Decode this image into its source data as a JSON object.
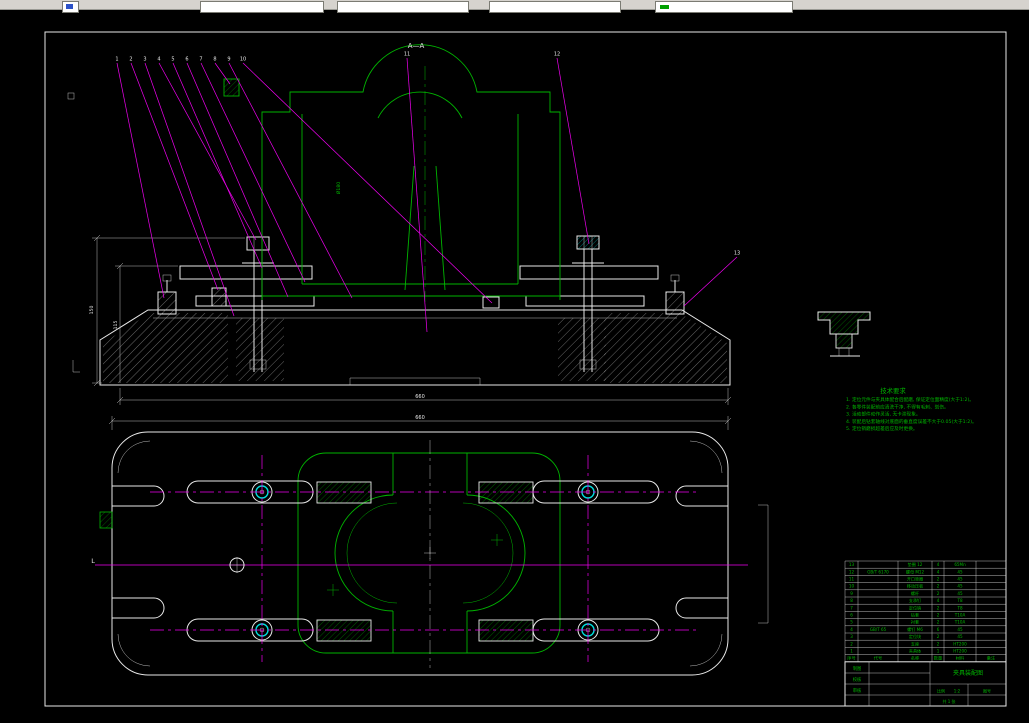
{
  "colors": {
    "background": "#000000",
    "line_white": "#e9e9e9",
    "line_green": "#00b400",
    "line_magenta": "#f000f0",
    "line_cyan": "#00dcdc",
    "toolbar_bg": "#d6d3ce"
  },
  "drawing": {
    "section_label": "A—A",
    "balloons": [
      "1",
      "2",
      "3",
      "4",
      "5",
      "6",
      "7",
      "8",
      "9",
      "10",
      "11",
      "12",
      "13"
    ],
    "dimensions": {
      "overall_width": "660",
      "plan_width": "660",
      "height_a": "150",
      "height_b": "115",
      "bore": "Ø180"
    },
    "view_labels": {
      "left_mark": "L"
    },
    "notes": {
      "title": "技术要求",
      "lines": [
        "1. 定位元件与夹具体配合后配磨, 保证定位面精度(大于1:2)。",
        "2. 各零件装配前应清洗干净, 不得有毛刺、划伤。",
        "3. 活动部件动作灵活, 无卡滞现象。",
        "4. 装配后钻套轴线对底面的垂直度误差不大于0.05(大于1:2)。",
        "5. 定位销磨损超差后应及时更换。"
      ]
    },
    "bom": {
      "headers": [
        "序号",
        "代号",
        "名称",
        "数量",
        "材料",
        "备注"
      ],
      "rows": [
        [
          "13",
          "",
          "垫圈 12",
          "4",
          "65Mn",
          ""
        ],
        [
          "12",
          "GB/T 6170",
          "螺母 M12",
          "4",
          "45",
          ""
        ],
        [
          "11",
          "",
          "开口垫圈",
          "2",
          "45",
          ""
        ],
        [
          "10",
          "",
          "移动压板",
          "2",
          "45",
          ""
        ],
        [
          "9",
          "",
          "螺杆",
          "2",
          "45",
          ""
        ],
        [
          "8",
          "",
          "支承钉",
          "4",
          "T8",
          ""
        ],
        [
          "7",
          "",
          "定位销",
          "2",
          "T8",
          ""
        ],
        [
          "6",
          "",
          "钻套",
          "2",
          "T10A",
          ""
        ],
        [
          "5",
          "",
          "衬套",
          "2",
          "T10A",
          ""
        ],
        [
          "4",
          "GB/T 65",
          "螺钉 M6",
          "6",
          "45",
          ""
        ],
        [
          "3",
          "",
          "定位块",
          "2",
          "45",
          ""
        ],
        [
          "2",
          "",
          "支座",
          "2",
          "HT200",
          ""
        ],
        [
          "1",
          "",
          "夹具体",
          "1",
          "HT200",
          ""
        ]
      ]
    },
    "titleblock": {
      "left_labels": [
        "制图",
        "校核",
        "审核"
      ],
      "title": "夹具装配图",
      "scale_label": "比例",
      "scale": "1:2",
      "sheet_label": "共 1 张",
      "code_label": "图号"
    }
  }
}
